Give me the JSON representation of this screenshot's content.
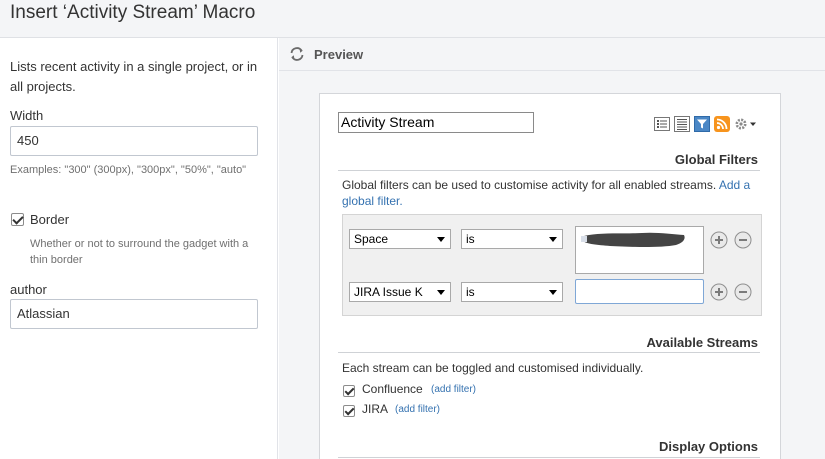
{
  "dialog": {
    "title": "Insert ‘Activity Stream’ Macro"
  },
  "left_panel": {
    "description": "Lists recent activity in a single project, or in all projects.",
    "width": {
      "label": "Width",
      "value": "450",
      "help": "Examples: \"300\" (300px), \"300px\", \"50%\", \"auto\""
    },
    "border": {
      "label": "Border",
      "checked": true,
      "help": "Whether or not to surround the gadget with a thin border"
    },
    "author": {
      "label": "author",
      "value": "Atlassian"
    }
  },
  "preview": {
    "label": "Preview",
    "gadget": {
      "title_value": "Activity Stream",
      "icons": [
        "list-view-icon",
        "detail-view-icon",
        "filter-icon",
        "rss-icon",
        "gear-menu-icon"
      ],
      "global_filters": {
        "heading": "Global Filters",
        "description": "Global filters can be used to customise activity for all enabled streams.",
        "add_link": "Add a global filter.",
        "rows": [
          {
            "field": "Space",
            "operator": "is",
            "value": ""
          },
          {
            "field": "JIRA Issue K",
            "operator": "is",
            "value": ""
          }
        ]
      },
      "available_streams": {
        "heading": "Available Streams",
        "description": "Each stream can be toggled and customised individually.",
        "streams": [
          {
            "name": "Confluence",
            "checked": true,
            "link": "(add filter)"
          },
          {
            "name": "JIRA",
            "checked": true,
            "link": "(add filter)"
          }
        ]
      },
      "display_options": {
        "heading": "Display Options"
      }
    }
  },
  "colors": {
    "link": "#3572b0",
    "panel_bg": "#f4f5f7",
    "rss": "#f7941d",
    "filter_active": "#4a87c6"
  }
}
